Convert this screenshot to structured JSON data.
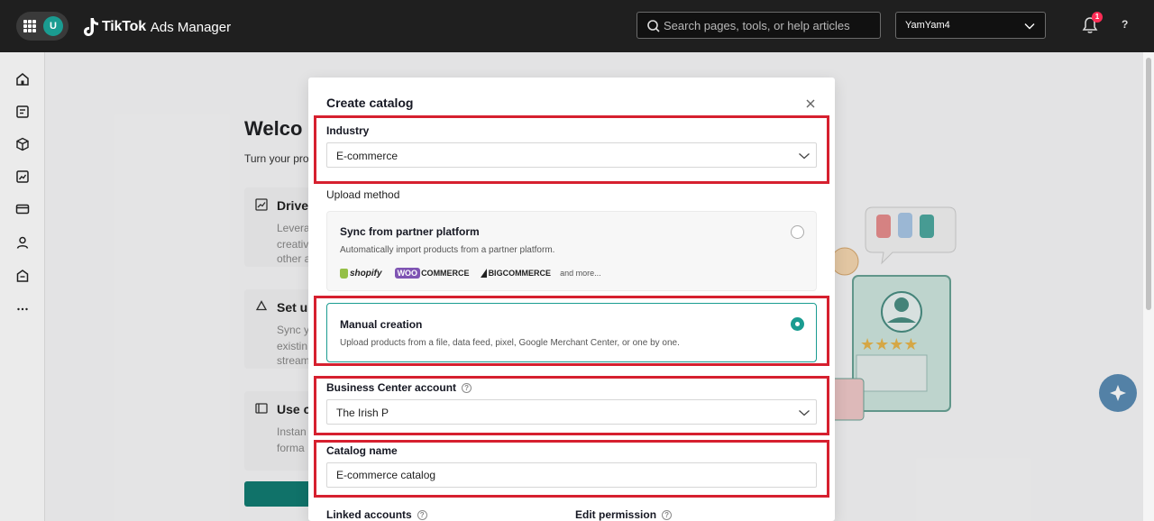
{
  "topbar": {
    "avatar_initial": "U",
    "brand_name": "TikTok",
    "brand_sub": "Ads Manager",
    "search_placeholder": "Search pages, tools, or help articles",
    "account_name": "YamYam4",
    "notification_count": "1",
    "help_label": "?"
  },
  "background": {
    "welcome_title": "Welco",
    "welcome_sub": "Turn your pro",
    "cards": [
      {
        "title": "Drive",
        "lines": [
          "Levera",
          "creativ",
          "other a"
        ]
      },
      {
        "title": "Set u",
        "lines": [
          "Sync y",
          "existin",
          "stream"
        ]
      },
      {
        "title": "Use c",
        "lines": [
          "Instan",
          "forma"
        ]
      }
    ]
  },
  "modal": {
    "title": "Create catalog",
    "industry_label": "Industry",
    "industry_value": "E-commerce",
    "upload_method_label": "Upload method",
    "partner_option": {
      "title": "Sync from partner platform",
      "description": "Automatically import products from a partner platform.",
      "selected": false,
      "logos": {
        "shopify": "shopify",
        "woo_badge": "WOO",
        "woo_text": "COMMERCE",
        "bigcommerce": "BIGCOMMERCE",
        "more": "and more..."
      }
    },
    "manual_option": {
      "title": "Manual creation",
      "description": "Upload products from a file, data feed, pixel, Google Merchant Center, or one by one.",
      "selected": true
    },
    "bc_account_label": "Business Center account",
    "bc_account_value": "The Irish P",
    "catalog_name_label": "Catalog name",
    "catalog_name_value": "E-commerce catalog",
    "linked_accounts_label": "Linked accounts",
    "edit_permission_label": "Edit permission"
  },
  "colors": {
    "accent": "#1a9c91",
    "highlight": "#d6202f",
    "topbar": "#1f1f1f"
  },
  "icons": [
    "apps-grid-icon",
    "tiktok-logo-icon",
    "search-icon",
    "chevron-down-icon",
    "bell-icon",
    "home-icon",
    "campaign-icon",
    "catalog-icon",
    "analytics-icon",
    "billing-icon",
    "user-icon",
    "store-icon",
    "more-icon",
    "close-icon",
    "help-circle-icon"
  ]
}
